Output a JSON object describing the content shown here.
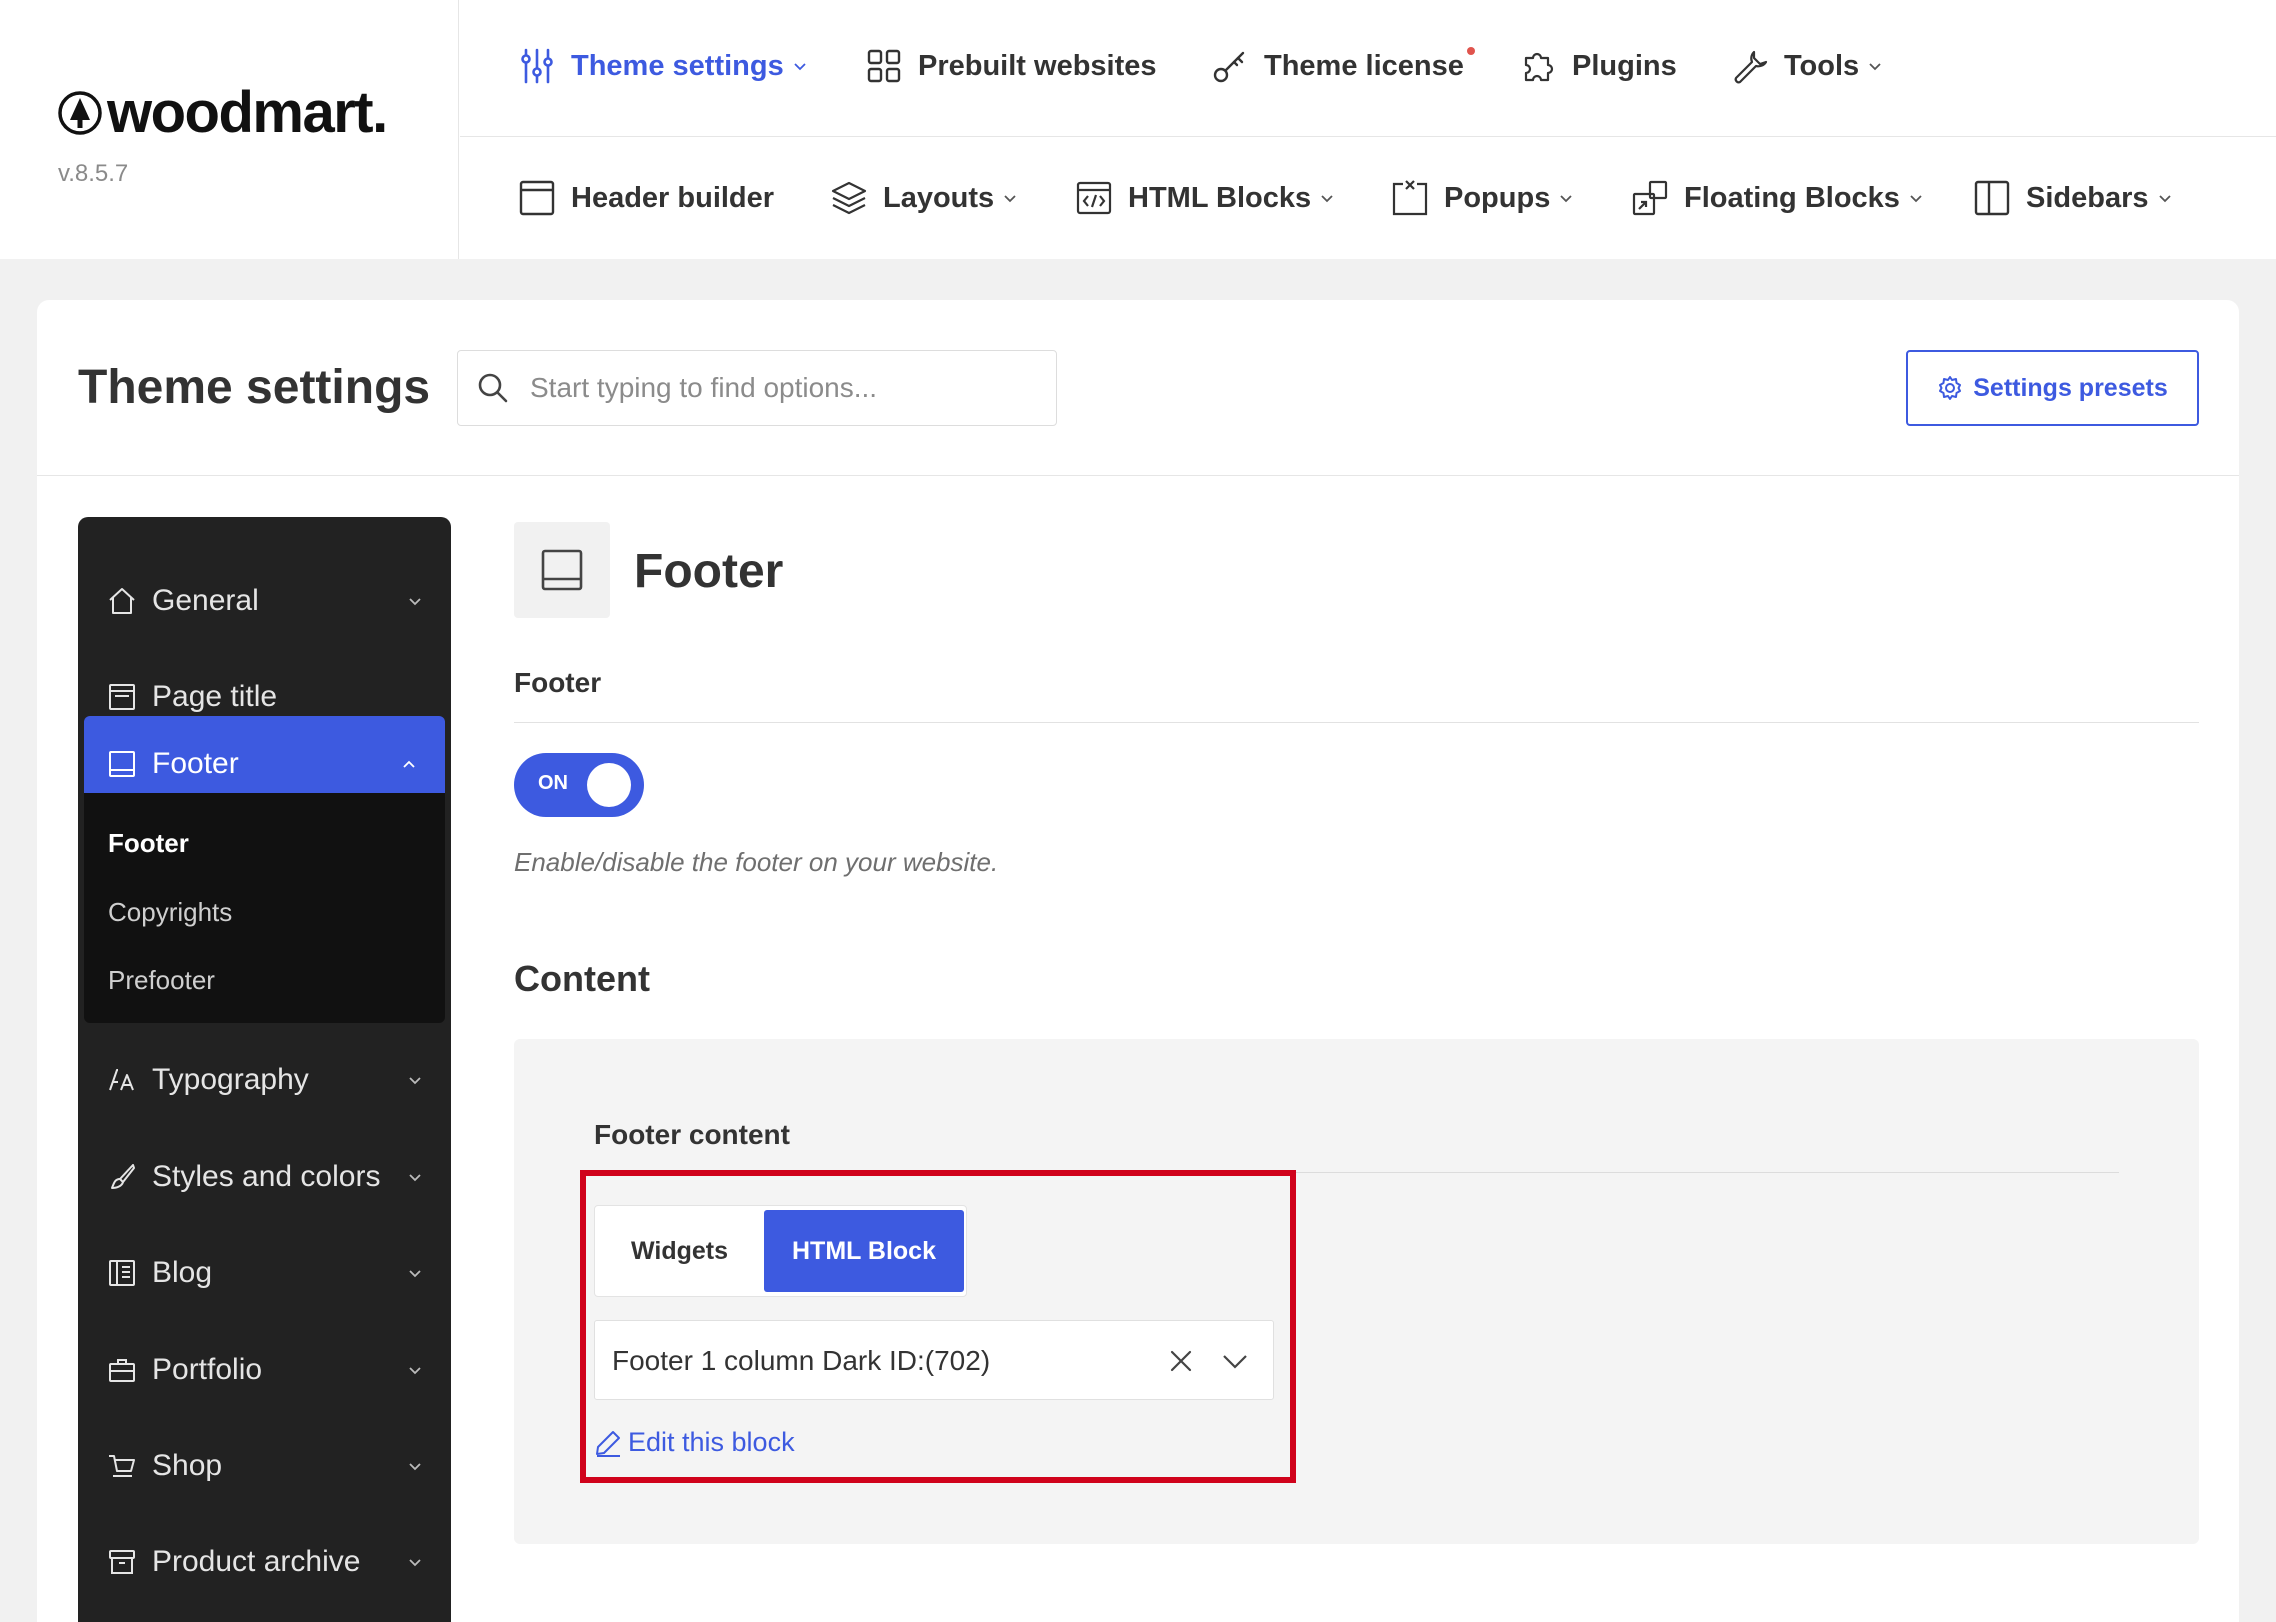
{
  "brand": {
    "name": "woodmart.",
    "version": "v.8.5.7"
  },
  "nav": {
    "row1": [
      {
        "label": "Theme settings",
        "icon": "sliders-icon",
        "dropdown": true,
        "active": true
      },
      {
        "label": "Prebuilt websites",
        "icon": "grid-icon",
        "dropdown": false
      },
      {
        "label": "Theme license",
        "icon": "key-icon",
        "dropdown": false,
        "notification": true
      },
      {
        "label": "Plugins",
        "icon": "puzzle-icon",
        "dropdown": false
      },
      {
        "label": "Tools",
        "icon": "wrench-icon",
        "dropdown": true
      }
    ],
    "row2": [
      {
        "label": "Header builder",
        "icon": "header-icon",
        "dropdown": false
      },
      {
        "label": "Layouts",
        "icon": "layers-icon",
        "dropdown": true
      },
      {
        "label": "HTML Blocks",
        "icon": "code-block-icon",
        "dropdown": true
      },
      {
        "label": "Popups",
        "icon": "popup-icon",
        "dropdown": true
      },
      {
        "label": "Floating Blocks",
        "icon": "floating-icon",
        "dropdown": true
      },
      {
        "label": "Sidebars",
        "icon": "sidebar-icon",
        "dropdown": true
      }
    ]
  },
  "header": {
    "title": "Theme settings",
    "search_placeholder": "Start typing to find options...",
    "presets_label": "Settings presets"
  },
  "sidebar": {
    "items": [
      {
        "label": "General",
        "icon": "home-icon"
      },
      {
        "label": "Page title",
        "icon": "page-title-icon"
      },
      {
        "label": "Footer",
        "icon": "footer-icon",
        "active": true
      },
      {
        "label": "Typography",
        "icon": "typography-icon"
      },
      {
        "label": "Styles and colors",
        "icon": "brush-icon"
      },
      {
        "label": "Blog",
        "icon": "blog-icon"
      },
      {
        "label": "Portfolio",
        "icon": "briefcase-icon"
      },
      {
        "label": "Shop",
        "icon": "cart-icon"
      },
      {
        "label": "Product archive",
        "icon": "archive-icon"
      }
    ],
    "submenu": [
      {
        "label": "Footer",
        "current": true
      },
      {
        "label": "Copyrights"
      },
      {
        "label": "Prefooter"
      }
    ]
  },
  "section": {
    "title": "Footer",
    "footer_label": "Footer",
    "toggle_label": "ON",
    "toggle_on": true,
    "description": "Enable/disable the footer on your website.",
    "content_heading": "Content",
    "footer_content_label": "Footer content",
    "tabs": [
      "Widgets",
      "HTML Block"
    ],
    "selected_tab": "HTML Block",
    "selected_block": "Footer 1 column Dark ID:(702)",
    "edit_link": "Edit this block"
  },
  "colors": {
    "accent": "#3d5ae0",
    "sidebar_bg": "#222222",
    "highlight": "#d0021b",
    "notification": "#e0544d"
  }
}
